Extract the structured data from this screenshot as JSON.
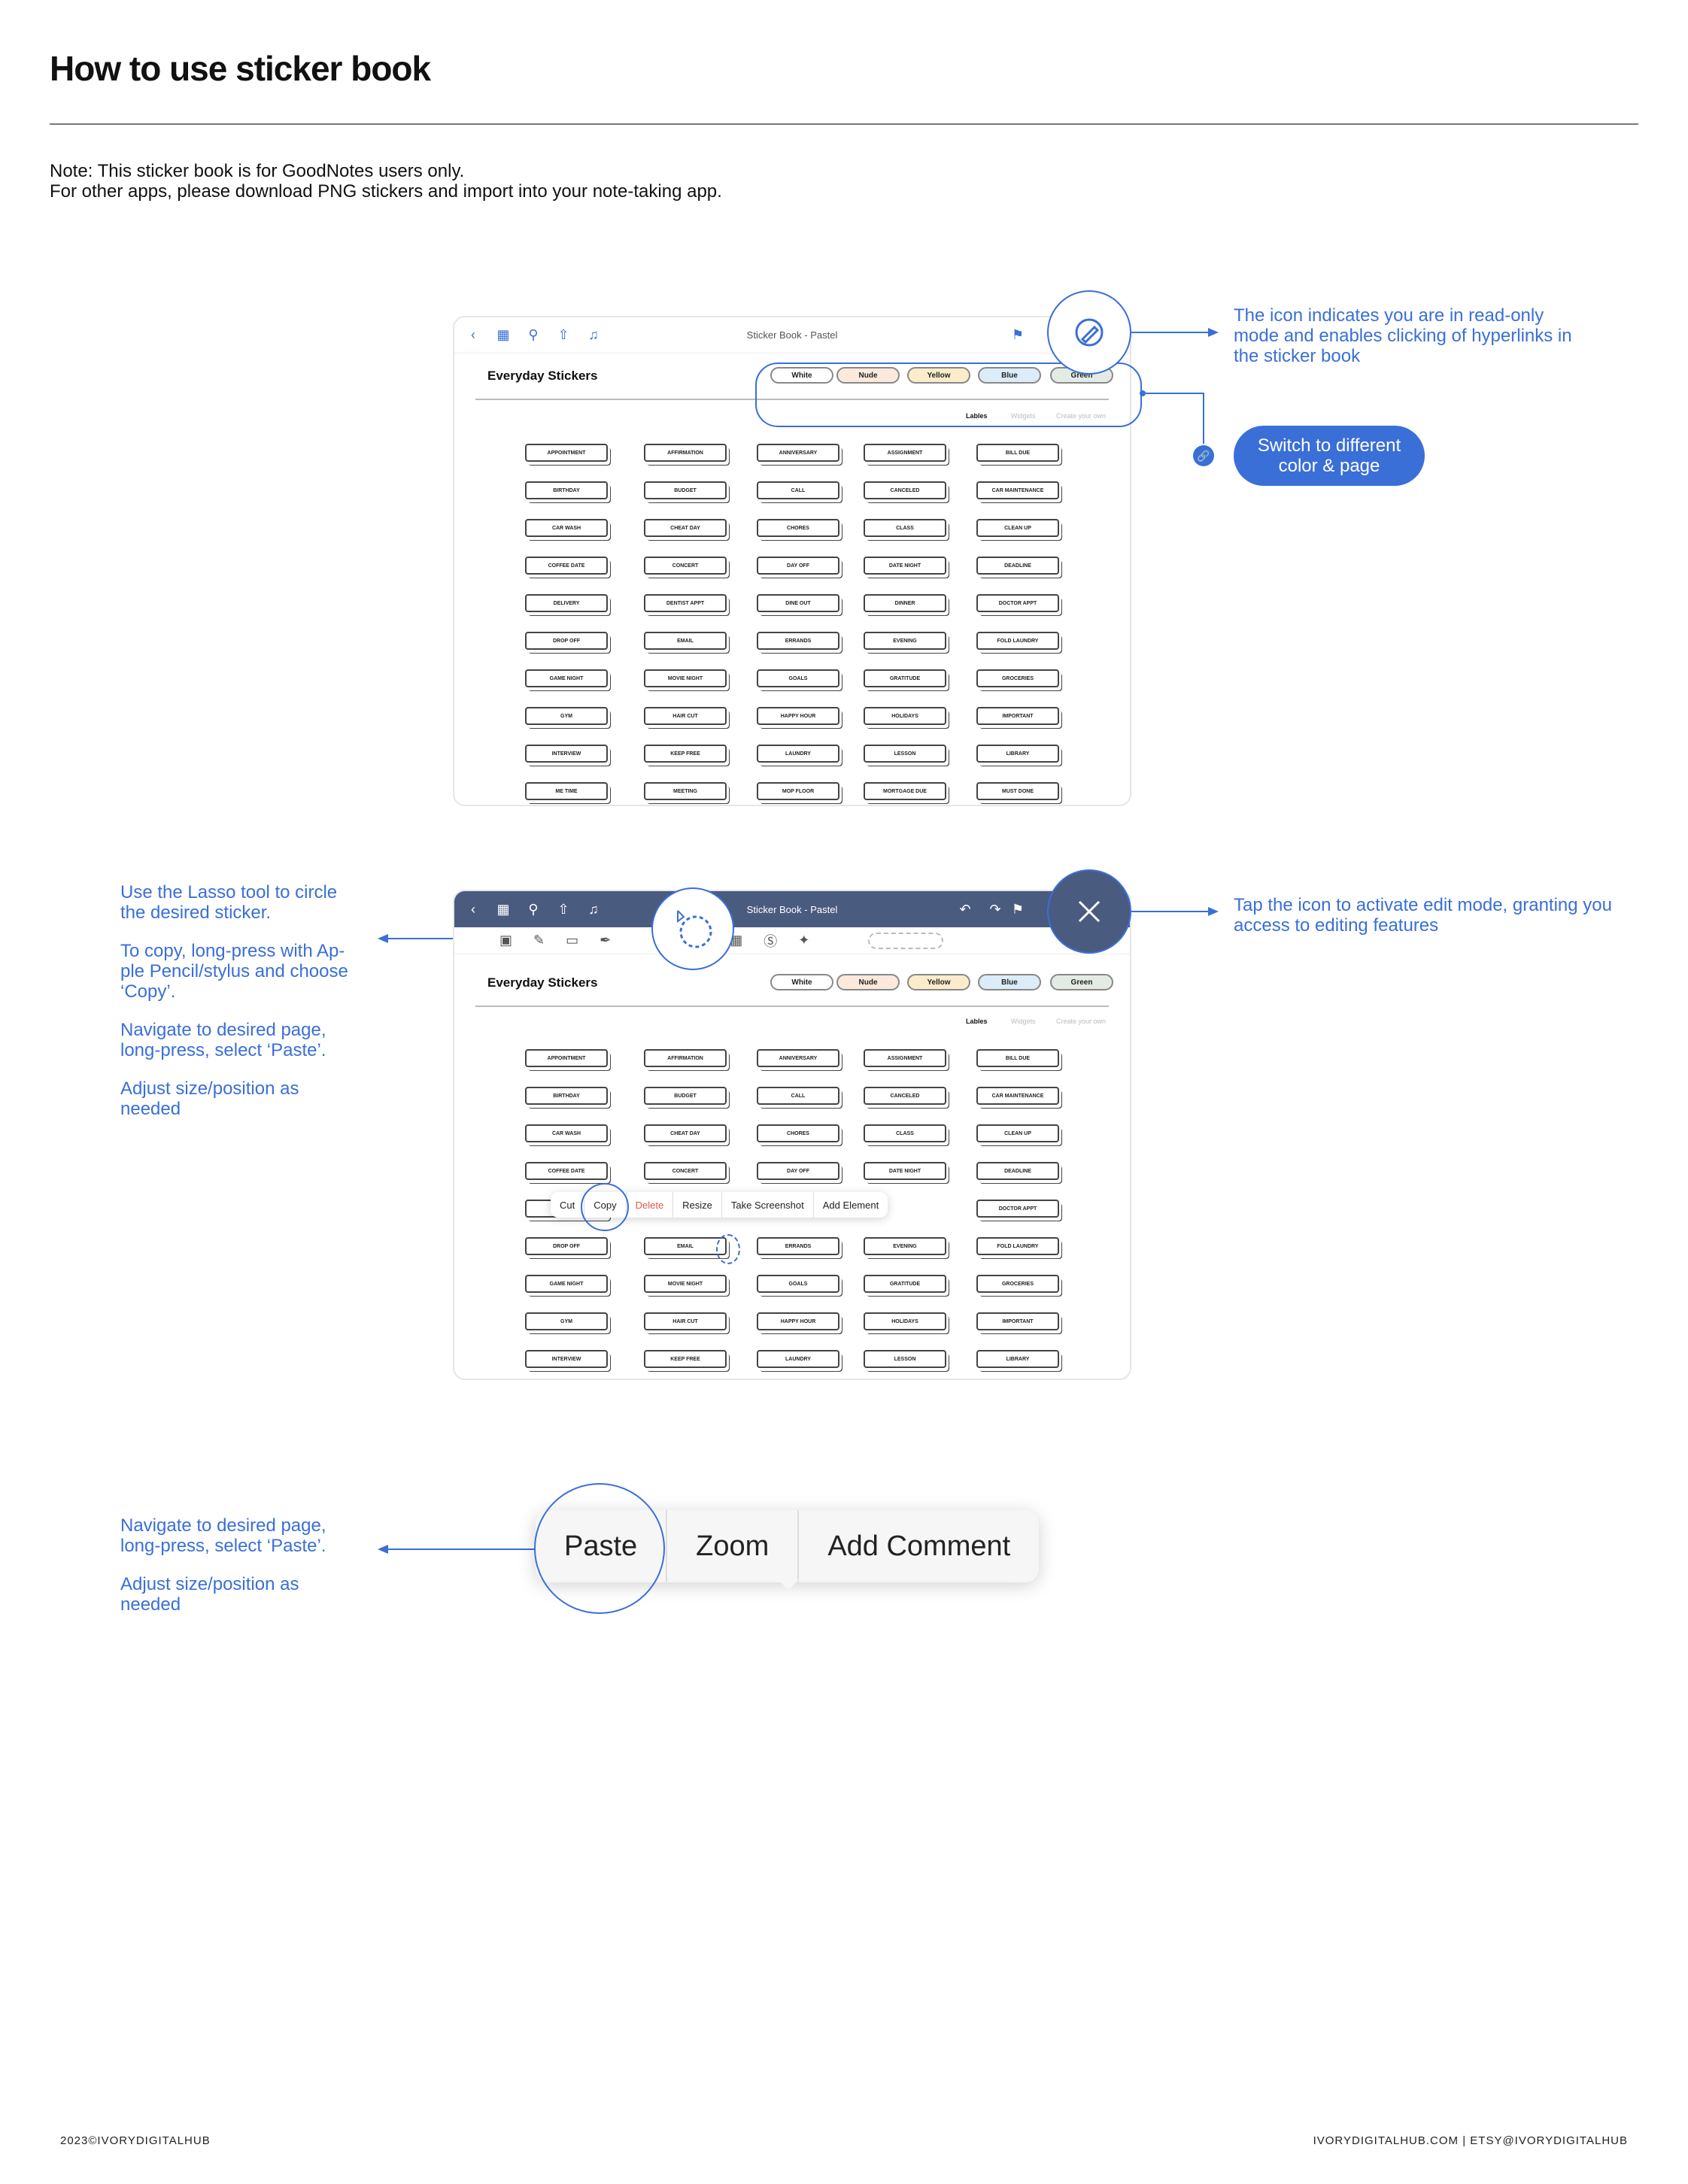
{
  "page": {
    "title": "How to use sticker book",
    "note_line1": "Note: This sticker book is for GoodNotes users only.",
    "note_line2": "For other apps, please download PNG stickers and import into your note-taking app."
  },
  "tablet": {
    "doc_title": "Sticker Book - Pastel",
    "sticker_page_title": "Everyday Stickers",
    "color_chips": [
      {
        "label": "White",
        "color": "#ffffff"
      },
      {
        "label": "Nude",
        "color": "#fbe9dc"
      },
      {
        "label": "Yellow",
        "color": "#fbeccb"
      },
      {
        "label": "Blue",
        "color": "#dcecf8"
      },
      {
        "label": "Green",
        "color": "#e3ece4"
      }
    ],
    "tabs": [
      "Lables",
      "Widgets",
      "Create your own"
    ],
    "stickers": [
      [
        "APPOINTMENT",
        "AFFIRMATION",
        "ANNIVERSARY",
        "ASSIGNMENT",
        "BILL DUE"
      ],
      [
        "BIRTHDAY",
        "BUDGET",
        "CALL",
        "CANCELED",
        "CAR MAINTENANCE"
      ],
      [
        "CAR WASH",
        "CHEAT DAY",
        "CHORES",
        "CLASS",
        "CLEAN UP"
      ],
      [
        "COFFEE DATE",
        "CONCERT",
        "DAY OFF",
        "DATE NIGHT",
        "DEADLINE"
      ],
      [
        "DELIVERY",
        "DENTIST APPT",
        "DINE OUT",
        "DINNER",
        "DOCTOR APPT"
      ],
      [
        "DROP OFF",
        "EMAIL",
        "ERRANDS",
        "EVENING",
        "FOLD LAUNDRY"
      ],
      [
        "GAME NIGHT",
        "MOVIE NIGHT",
        "GOALS",
        "GRATITUDE",
        "GROCERIES"
      ],
      [
        "GYM",
        "HAIR CUT",
        "HAPPY HOUR",
        "HOLIDAYS",
        "IMPORTANT"
      ],
      [
        "INTERVIEW",
        "KEEP FREE",
        "LAUNDRY",
        "LESSON",
        "LIBRARY"
      ],
      [
        "ME TIME",
        "MEETING",
        "MOP FLOOR",
        "MORTGAGE DUE",
        "MUST DONE"
      ]
    ],
    "context_menu": [
      "Cut",
      "Copy",
      "Delete",
      "Resize",
      "Take Screenshot",
      "Add Element"
    ],
    "context_menu_delete_color": "#e0564d"
  },
  "annotations": {
    "read_only": "The icon indicates you are in read-only mode and enables clicking of hyperlinks in the sticker book",
    "switch_button": "Switch to different color & page",
    "edit_mode": "Tap the icon to activate edit mode, granting you access to editing features",
    "lasso": "Use the Lasso tool to circle the desired sticker.",
    "copy": "To copy, long-press with Ap-ple Pencil/stylus and choose ‘Copy’.",
    "navigate": "Navigate to desired page, long-press, select ‘Paste’.",
    "adjust": "Adjust size/position as needed",
    "navigate2": "Navigate to desired page, long-press, select ‘Paste’.",
    "adjust2": "Adjust size/position as needed"
  },
  "paste_menu": [
    "Paste",
    "Zoom",
    "Add Comment"
  ],
  "footer": {
    "left": "2023©IVORYDIGITALHUB",
    "right": "IVORYDIGITALHUB.COM | ETSY@IVORYDIGITALHUB"
  },
  "colors": {
    "accent": "#3a6fd8",
    "toolbar_dark": "#4a5b80"
  }
}
